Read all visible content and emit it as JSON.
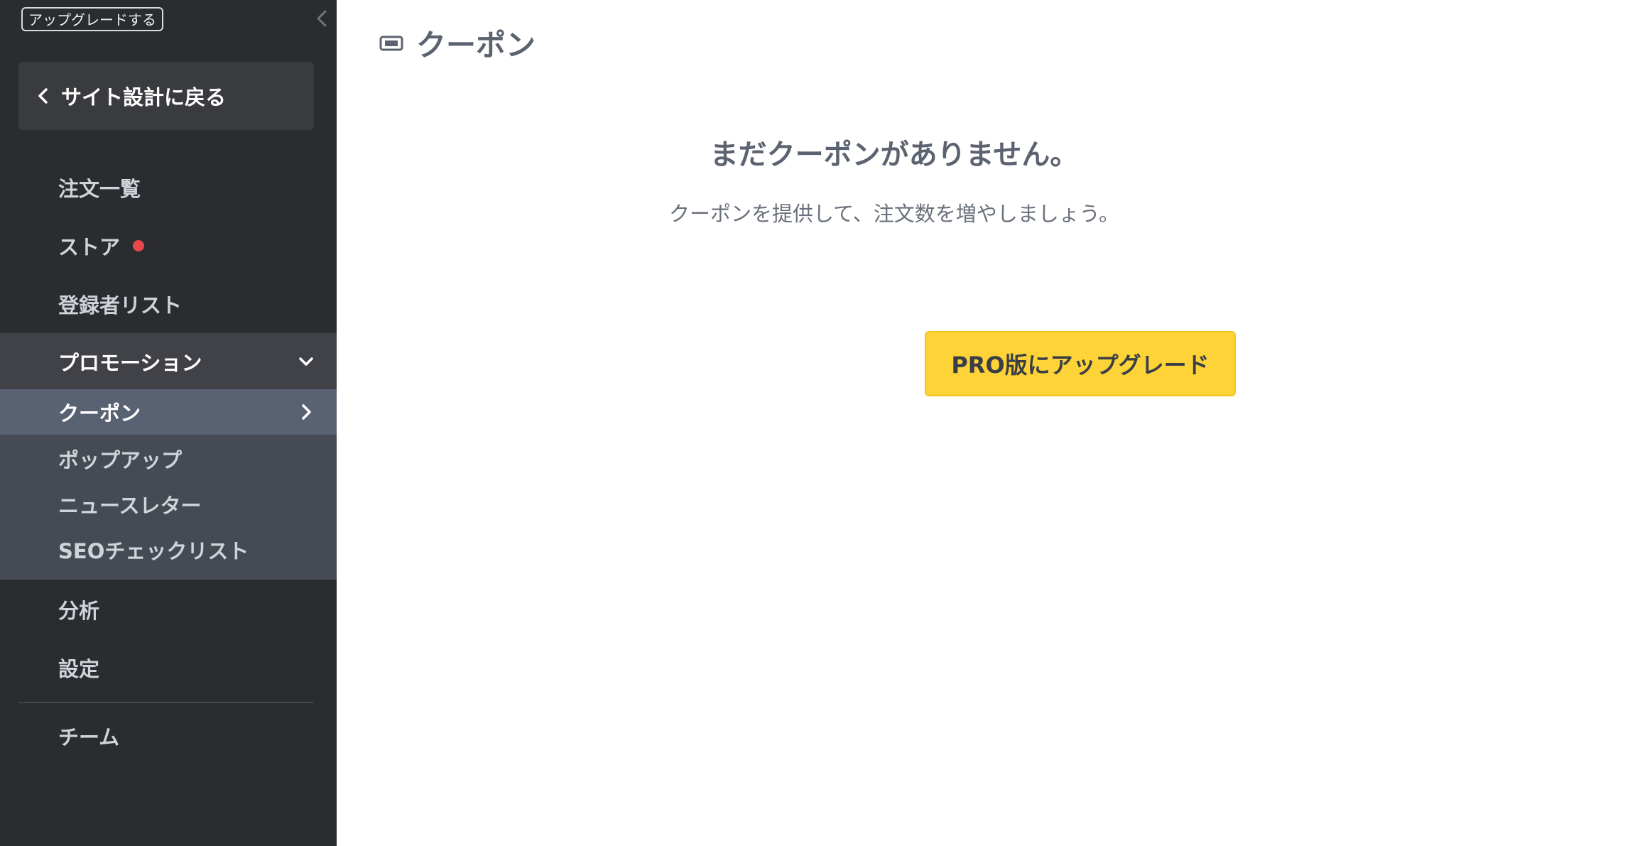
{
  "sidebar": {
    "upgrade_chip": "アップグレードする",
    "back_button_label": "サイト設計に戻る",
    "items": {
      "orders": "注文一覧",
      "store": "ストア",
      "subscribers": "登録者リスト",
      "promotion": "プロモーション",
      "coupon": "クーポン",
      "popup": "ポップアップ",
      "newsletter": "ニュースレター",
      "seo_checklist": "SEOチェックリスト",
      "analytics": "分析",
      "settings": "設定",
      "team": "チーム"
    },
    "store_notification_color": "#e5484d"
  },
  "main": {
    "page_title": "クーポン",
    "page_icon": "ticket-icon",
    "empty_title": "まだクーポンがありません。",
    "empty_subtitle": "クーポンを提供して、注文数を増やしましょう。",
    "upgrade_button_label": "PRO版にアップグレード"
  },
  "colors": {
    "sidebar_bg": "#2b2c2f",
    "active_item_bg": "#596273",
    "upgrade_button": "#fdd337"
  }
}
